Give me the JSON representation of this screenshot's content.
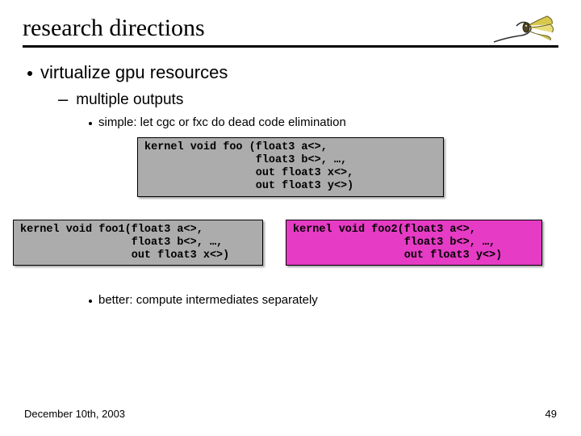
{
  "title": "research directions",
  "bullets": {
    "b1": "virtualize gpu resources",
    "b2": "multiple outputs",
    "b3a": "simple:  let cgc or fxc do dead code elimination",
    "b3b": "better:  compute intermediates separately"
  },
  "code": {
    "top": "kernel void foo (float3 a<>,\n                 float3 b<>, …,\n                 out float3 x<>,\n                 out float3 y<>)",
    "left": "kernel void foo1(float3 a<>,\n                 float3 b<>, …,\n                 out float3 x<>)",
    "right": "kernel void foo2(float3 a<>,\n                 float3 b<>, …,\n                 out float3 y<>)"
  },
  "footer": {
    "date": "December 10th, 2003",
    "page": "49"
  },
  "icons": {
    "logo": "feathered-lure-icon"
  }
}
